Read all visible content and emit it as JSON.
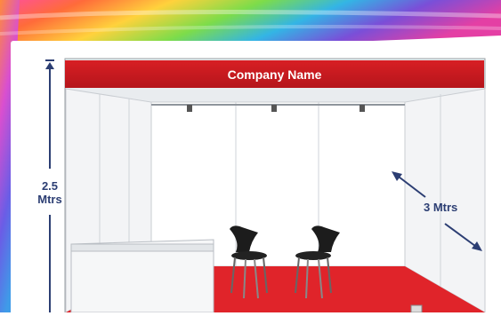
{
  "booth": {
    "company_name": "Company Name",
    "height_label_line1": "2.5",
    "height_label_line2": "Mtrs",
    "depth_label": "3 Mtrs"
  },
  "colors": {
    "fascia_red": "#c8191f",
    "carpet_red": "#e0242a",
    "dimension_blue": "#2c3e73"
  }
}
